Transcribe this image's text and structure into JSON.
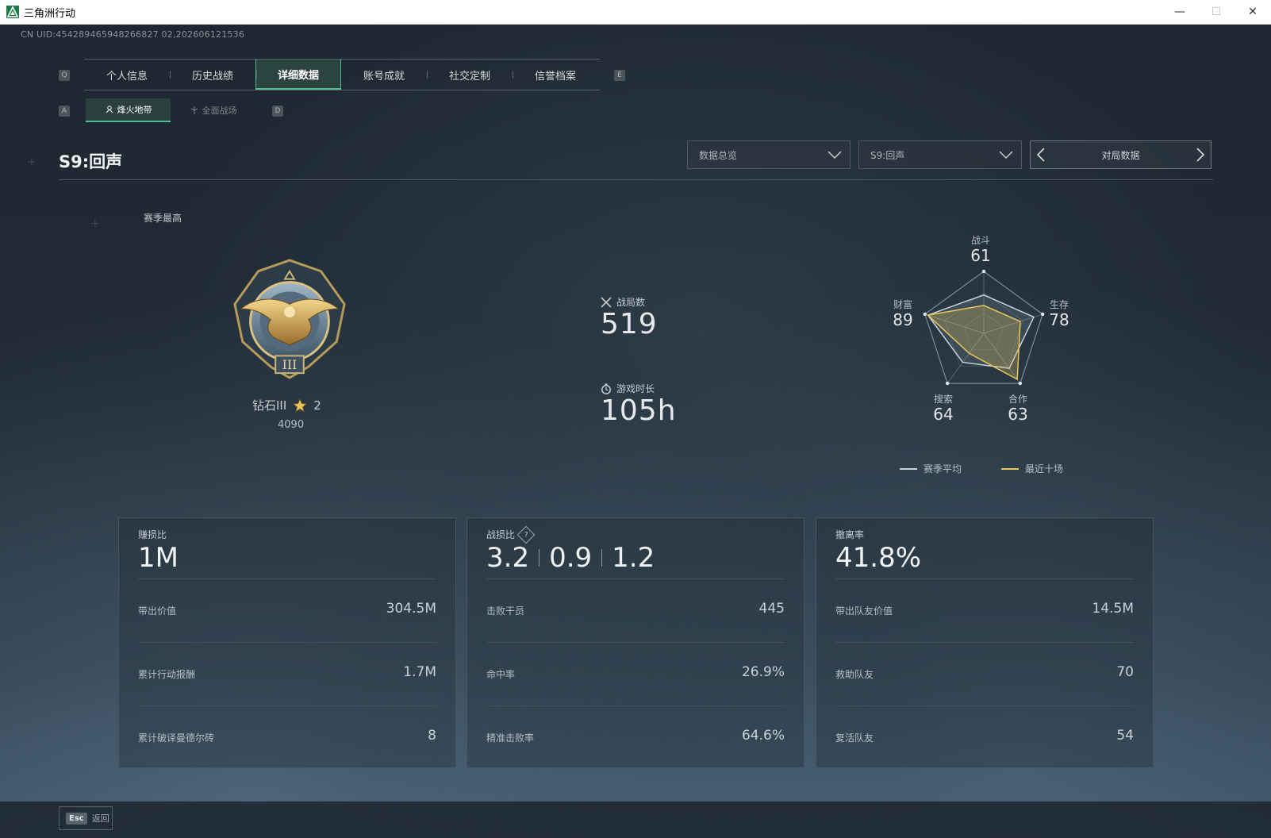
{
  "window": {
    "title": "三角洲行动",
    "minimize": "—",
    "maximize": "☐",
    "close": "✕"
  },
  "uid": "CN UID:454289465948266827 02,202606121536",
  "tabs": {
    "key_left": "Q",
    "key_right": "E",
    "items": [
      {
        "label": "个人信息"
      },
      {
        "label": "历史战绩"
      },
      {
        "label": "详细数据",
        "active": true
      },
      {
        "label": "账号成就"
      },
      {
        "label": "社交定制"
      },
      {
        "label": "信誉档案"
      }
    ]
  },
  "subtabs": {
    "key_left": "A",
    "key_right": "D",
    "items": [
      {
        "label": "烽火地带",
        "active": true
      },
      {
        "label": "全面战场"
      }
    ]
  },
  "header": {
    "season_title": "S9:回声",
    "dropdown_mode": "数据总览",
    "dropdown_season": "S9:回声",
    "pager_label": "对局数据"
  },
  "rank": {
    "section_label": "赛季最高",
    "name": "钻石III",
    "stars": "2",
    "score": "4090"
  },
  "stats": {
    "matches_label": "战局数",
    "matches_value": "519",
    "playtime_label": "游戏时长",
    "playtime_value": "105h"
  },
  "radar": {
    "axes": [
      {
        "label": "战斗",
        "value": "61"
      },
      {
        "label": "生存",
        "value": "78"
      },
      {
        "label": "合作",
        "value": "63"
      },
      {
        "label": "搜索",
        "value": "64"
      },
      {
        "label": "财富",
        "value": "89"
      }
    ],
    "season_avg": [
      0.62,
      0.85,
      0.7,
      0.58,
      0.95
    ],
    "recent_ten": [
      0.45,
      0.62,
      0.92,
      0.4,
      0.95
    ],
    "legend_avg": "赛季平均",
    "legend_recent": "最近十场",
    "color_avg": "#c9d2d9",
    "color_recent": "#e8c65a"
  },
  "cards": [
    {
      "title": "赚损比",
      "big": "1M",
      "rows": [
        {
          "label": "带出价值",
          "value": "304.5M"
        },
        {
          "label": "累计行动报酬",
          "value": "1.7M"
        },
        {
          "label": "累计破译曼德尔砖",
          "value": "8"
        }
      ]
    },
    {
      "title": "战损比",
      "help": "?",
      "big_parts": [
        "3.2",
        "0.9",
        "1.2"
      ],
      "rows": [
        {
          "label": "击败干员",
          "value": "445"
        },
        {
          "label": "命中率",
          "value": "26.9%"
        },
        {
          "label": "精准击败率",
          "value": "64.6%"
        }
      ]
    },
    {
      "title": "撤离率",
      "big": "41.8%",
      "rows": [
        {
          "label": "带出队友价值",
          "value": "14.5M"
        },
        {
          "label": "救助队友",
          "value": "70"
        },
        {
          "label": "复活队友",
          "value": "54"
        }
      ]
    }
  ],
  "footer": {
    "esc_key": "Esc",
    "back_label": "返回"
  },
  "colors": {
    "accent": "#4fbf91",
    "gold": "#e8c65a"
  }
}
